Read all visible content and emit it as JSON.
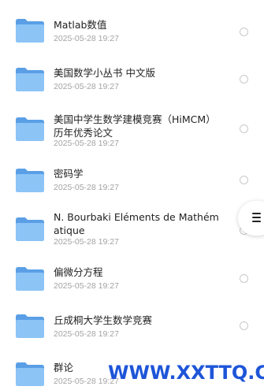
{
  "files": [
    {
      "name": "Matlab数值",
      "date": "2025-05-28 19:27",
      "icon": "folder-icon"
    },
    {
      "name": "美国数学小丛书 中文版",
      "date": "2025-05-28 19:27",
      "icon": "folder-icon"
    },
    {
      "name": "美国中学生数学建模竞赛（HiMCM）历年优秀论文",
      "date": "2025-05-28 19:27",
      "icon": "folder-icon"
    },
    {
      "name": "密码学",
      "date": "2025-05-28 19:27",
      "icon": "folder-icon"
    },
    {
      "name": "N. Bourbaki Eléments de Mathématique",
      "date": "2025-05-28 19:27",
      "icon": "folder-icon"
    },
    {
      "name": "偏微分方程",
      "date": "2025-05-28 19:27",
      "icon": "folder-icon"
    },
    {
      "name": "丘成桐大学生数学竞赛",
      "date": "2025-05-28 19:27",
      "icon": "folder-icon"
    },
    {
      "name": "群论",
      "date": "2025-05-28 19:27",
      "icon": "folder-icon"
    }
  ],
  "menu_button": {
    "icon": "menu-icon"
  },
  "watermark": "WWW.XXTTQ.COM",
  "colors": {
    "folder_back": "#5a9fe6",
    "folder_front": "#8cc4f6",
    "watermark": "#1e55d8"
  }
}
